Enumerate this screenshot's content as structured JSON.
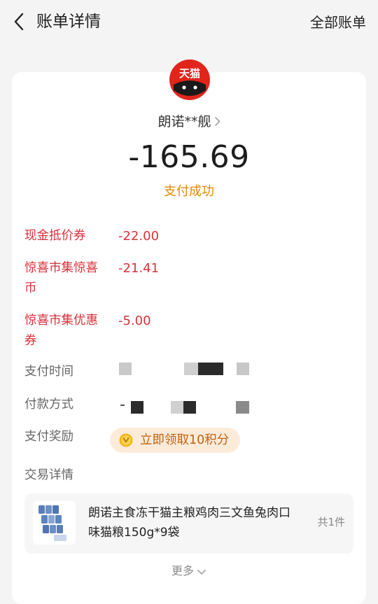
{
  "header": {
    "title": "账单详情",
    "all_bills": "全部账单"
  },
  "merchant": {
    "logo_text": "天猫",
    "name": "朗诺**舰"
  },
  "payment": {
    "amount": "-165.69",
    "status": "支付成功"
  },
  "discounts": [
    {
      "label": "现金抵价券",
      "value": "-22.00"
    },
    {
      "label": "惊喜市集惊喜币",
      "value": "-21.41"
    },
    {
      "label": "惊喜市集优惠券",
      "value": "-5.00"
    }
  ],
  "details": {
    "pay_time_label": "支付时间",
    "pay_method_label": "付款方式",
    "reward_label": "支付奖励",
    "reward_button": "立即领取10积分",
    "trade_detail_label": "交易详情"
  },
  "product": {
    "name": "朗诺主食冻干猫主粮鸡肉三文鱼兔肉口味猫粮150g*9袋",
    "quantity": "共1件"
  },
  "more_label": "更多",
  "colors": {
    "accent_red": "#d9313b",
    "status_orange": "#e08a00",
    "tmall_red": "#e1251b",
    "reward_bg": "#fdebd9"
  }
}
